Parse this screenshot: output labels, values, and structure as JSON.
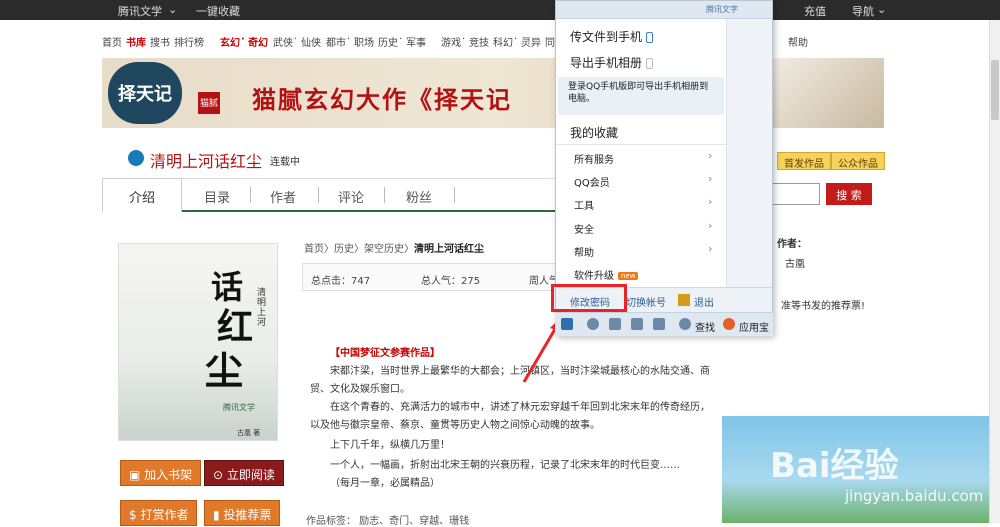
{
  "topbar": {
    "brand": "腾讯文学",
    "brand_arrow": "⌄",
    "fav": "一键收藏",
    "recharge": "充值",
    "nav": "导航",
    "nav_arrow": "⌄"
  },
  "nav": {
    "items": [
      "首页",
      "书库",
      "搜书",
      "排行榜",
      "玄幻",
      "·",
      "奇幻",
      "武侠",
      "·",
      "仙侠",
      "都市",
      "·",
      "职场",
      "历史",
      "·",
      "军事",
      "游戏",
      "·",
      "竞技",
      "科幻",
      "·",
      "灵异",
      "同"
    ],
    "help": "帮助",
    "manage": "管理"
  },
  "banner": {
    "title": "猫腻玄幻大作《择天记",
    "logo": "择天记",
    "seal": "猫腻"
  },
  "book": {
    "title": "清明上河话红尘",
    "status": "连载中",
    "tag1": "首发作品",
    "tag2": "公众作品"
  },
  "tabs": [
    "介绍",
    "目录",
    "作者",
    "评论",
    "粉丝"
  ],
  "search": {
    "button": "搜 索"
  },
  "cover": {
    "c1": "话",
    "c2": "红",
    "c3": "尘",
    "sub": "清明上河",
    "publisher": "腾讯文学",
    "author": "古凰 著"
  },
  "crumb": {
    "home": "首页",
    "cat": "历史",
    "sub": "架空历史",
    "book": "清明上河话红尘"
  },
  "stats": {
    "clicks": "总点击：747",
    "pop": "总人气：275",
    "week": "周人气：38"
  },
  "desc": {
    "award": "【中国梦征文参赛作品】",
    "p1": "宋都汴梁，当时世界上最繁华的大都会；上河镇区，当时汴梁城最核心的水陆交通、商",
    "p1b": "贸、文化及娱乐窗口。",
    "p2": "在这个青春的、充满活力的城市中，讲述了林元宏穿越千年回到北宋末年的传奇经历，",
    "p2b": "以及他与徽宗皇帝、蔡京、童贯等历史人物之间惊心动魄的故事。",
    "p3": "上下几千年，纵横几万里！",
    "p4": "一个人，一幅画，折射出北宋王朝的兴衰历程，记录了北宋末年的时代巨变……",
    "p5": "（每月一章，必属精品）"
  },
  "tags_line": "作品标签：  励志、奇门、穿越、珊钱",
  "buttons": {
    "add_shelf": "加入书架",
    "read_now": "立即阅读",
    "reward": "打赏作者",
    "vote": "投推荐票"
  },
  "right": {
    "author_label": "作者：",
    "author_name": "古凰",
    "rec": "准等书发的推荐票!"
  },
  "watermark": {
    "logo": "Bai经验",
    "url": "jingyan.baidu.com"
  },
  "menu": {
    "send_phone": "传文件到手机",
    "export_album": "导出手机相册",
    "note": "登录QQ手机版即可导出手机相册到电脑。",
    "favorites": "我的收藏",
    "all_services": "所有服务",
    "qq_vip": "QQ会员",
    "tools": "工具",
    "security": "安全",
    "help": "帮助",
    "upgrade": "软件升级",
    "new_badge": "new",
    "change_pwd": "修改密码",
    "switch_account": "切换帐号",
    "logout": "退出",
    "top_text": "腾讯文字",
    "side_link": "《Q"
  },
  "toolbar": {
    "find": "查找",
    "appstore": "应用宝"
  },
  "side_items": {
    "hui": "回",
    "hui2": "回"
  }
}
